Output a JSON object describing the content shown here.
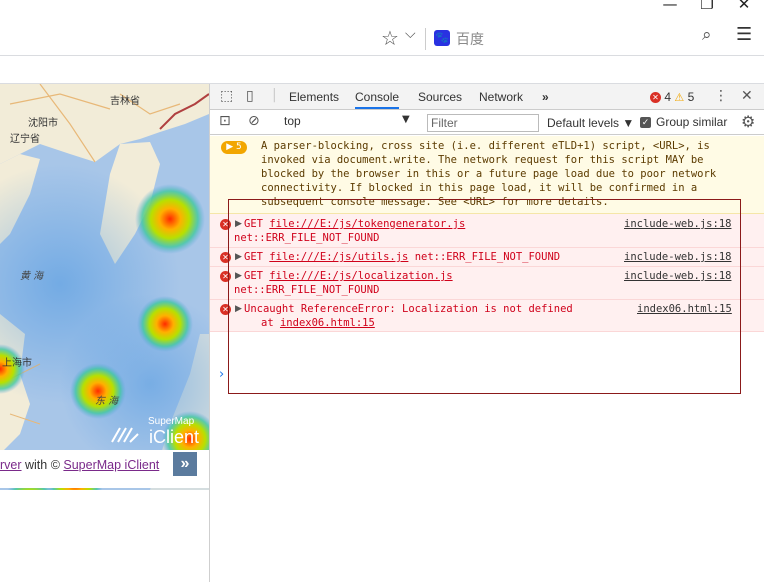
{
  "browser": {
    "minimize_icon": "—",
    "restore_icon": "❐",
    "close_icon": "✕",
    "search_placeholder": "百度",
    "baidu_logo_text": "🐾"
  },
  "map": {
    "cities": [
      {
        "name": "吉林省"
      },
      {
        "name": "沈阳市"
      },
      {
        "name": "辽宁省"
      },
      {
        "name": "上海市"
      }
    ],
    "seas": [
      "黄 海",
      "东 海"
    ],
    "logo_small": "SuperMap",
    "logo_big": "iClient",
    "attribution": {
      "part1": "rver",
      "with": " with © ",
      "link": "SuperMap iClient",
      "button": "»"
    }
  },
  "devtools": {
    "tabs": [
      {
        "label": "Elements",
        "active": false
      },
      {
        "label": "Console",
        "active": true
      },
      {
        "label": "Sources",
        "active": false
      },
      {
        "label": "Network",
        "active": false
      }
    ],
    "more_tabs": "»",
    "error_count": "4",
    "warning_count": "5",
    "context": "top",
    "filter_placeholder": "Filter",
    "levels": "Default levels ▼",
    "group_similar": "Group similar",
    "warning": {
      "badge": "▶ 5",
      "text": "A parser-blocking, cross site (i.e. different eTLD+1) script, <URL>, is\ninvoked via document.write. The network request for this script MAY be\nblocked by the browser in this or a future page load due to poor network\nconnectivity. If blocked in this page load, it will be confirmed in a\nsubsequent console message. See <URL> for more details."
    },
    "errors": [
      {
        "method": "GET",
        "url": "file:///E:/js/tokengenerator.js",
        "suffix": "",
        "sub": "net::ERR_FILE_NOT_FOUND",
        "source": "include-web.js:18"
      },
      {
        "method": "GET",
        "url": "file:///E:/js/utils.js",
        "suffix": " net::ERR_FILE_NOT_FOUND",
        "sub": "",
        "source": "include-web.js:18"
      },
      {
        "method": "GET",
        "url": "file:///E:/js/localization.js",
        "suffix": "",
        "sub": "net::ERR_FILE_NOT_FOUND",
        "source": "include-web.js:18"
      }
    ],
    "exception": {
      "text": "Uncaught ReferenceError: Localization is not defined",
      "at_label": "at",
      "at_link": "index06.html:15",
      "source": "index06.html:15"
    },
    "prompt": "›"
  },
  "colors": {
    "accent": "#1a73e8",
    "error": "#d93025",
    "warning": "#f2a600",
    "highlight_border": "#8b1a1a"
  }
}
